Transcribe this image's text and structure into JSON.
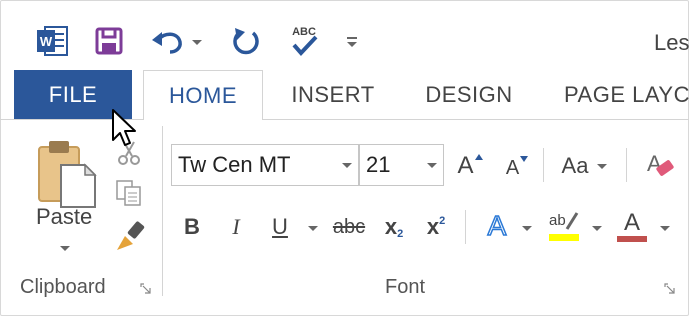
{
  "doc_title": "Les",
  "qat": {
    "items": [
      "word-icon",
      "save-icon",
      "undo-icon",
      "redo-icon",
      "spelling-icon",
      "customize-icon"
    ]
  },
  "tabs": [
    {
      "label": "FILE"
    },
    {
      "label": "HOME"
    },
    {
      "label": "INSERT"
    },
    {
      "label": "DESIGN"
    },
    {
      "label": "PAGE LAYC"
    }
  ],
  "clipboard": {
    "paste_label": "Paste",
    "group_label": "Clipboard"
  },
  "font": {
    "font_name": "Tw Cen MT",
    "font_size": "21",
    "group_label": "Font",
    "bold": "B",
    "italic": "I",
    "underline": "U",
    "strike": "abc",
    "subscript": "x",
    "subscript_mark": "2",
    "superscript": "x",
    "superscript_mark": "2",
    "grow_font": "A",
    "shrink_font": "A",
    "change_case": "Aa",
    "text_effects": "A",
    "highlight": "ab",
    "font_color": "A"
  },
  "colors": {
    "accent": "#2b579a",
    "highlight": "#ffff00",
    "font_color": "#c0504d"
  }
}
